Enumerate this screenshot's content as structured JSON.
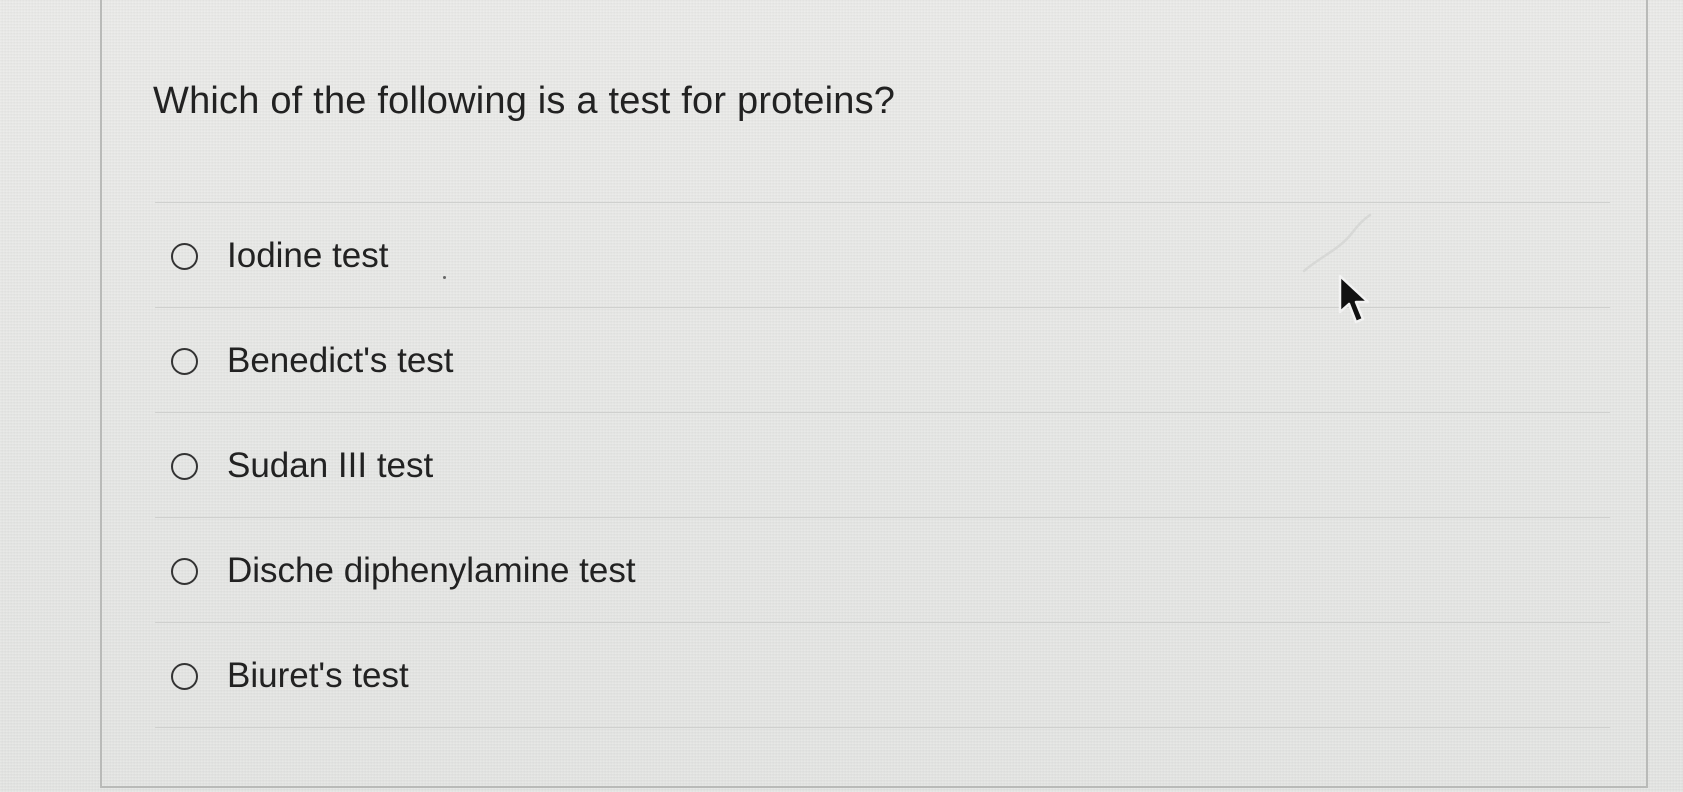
{
  "question": {
    "text": "Which of the following is a test for proteins?"
  },
  "options": [
    {
      "label": "Iodine test",
      "selected": false
    },
    {
      "label": "Benedict's test",
      "selected": false
    },
    {
      "label": "Sudan III test",
      "selected": false
    },
    {
      "label": "Dische diphenylamine test",
      "selected": false
    },
    {
      "label": "Biuret's test",
      "selected": false
    }
  ],
  "icons": {
    "radio": "radio-unselected-icon",
    "cursor": "mouse-pointer-icon"
  }
}
